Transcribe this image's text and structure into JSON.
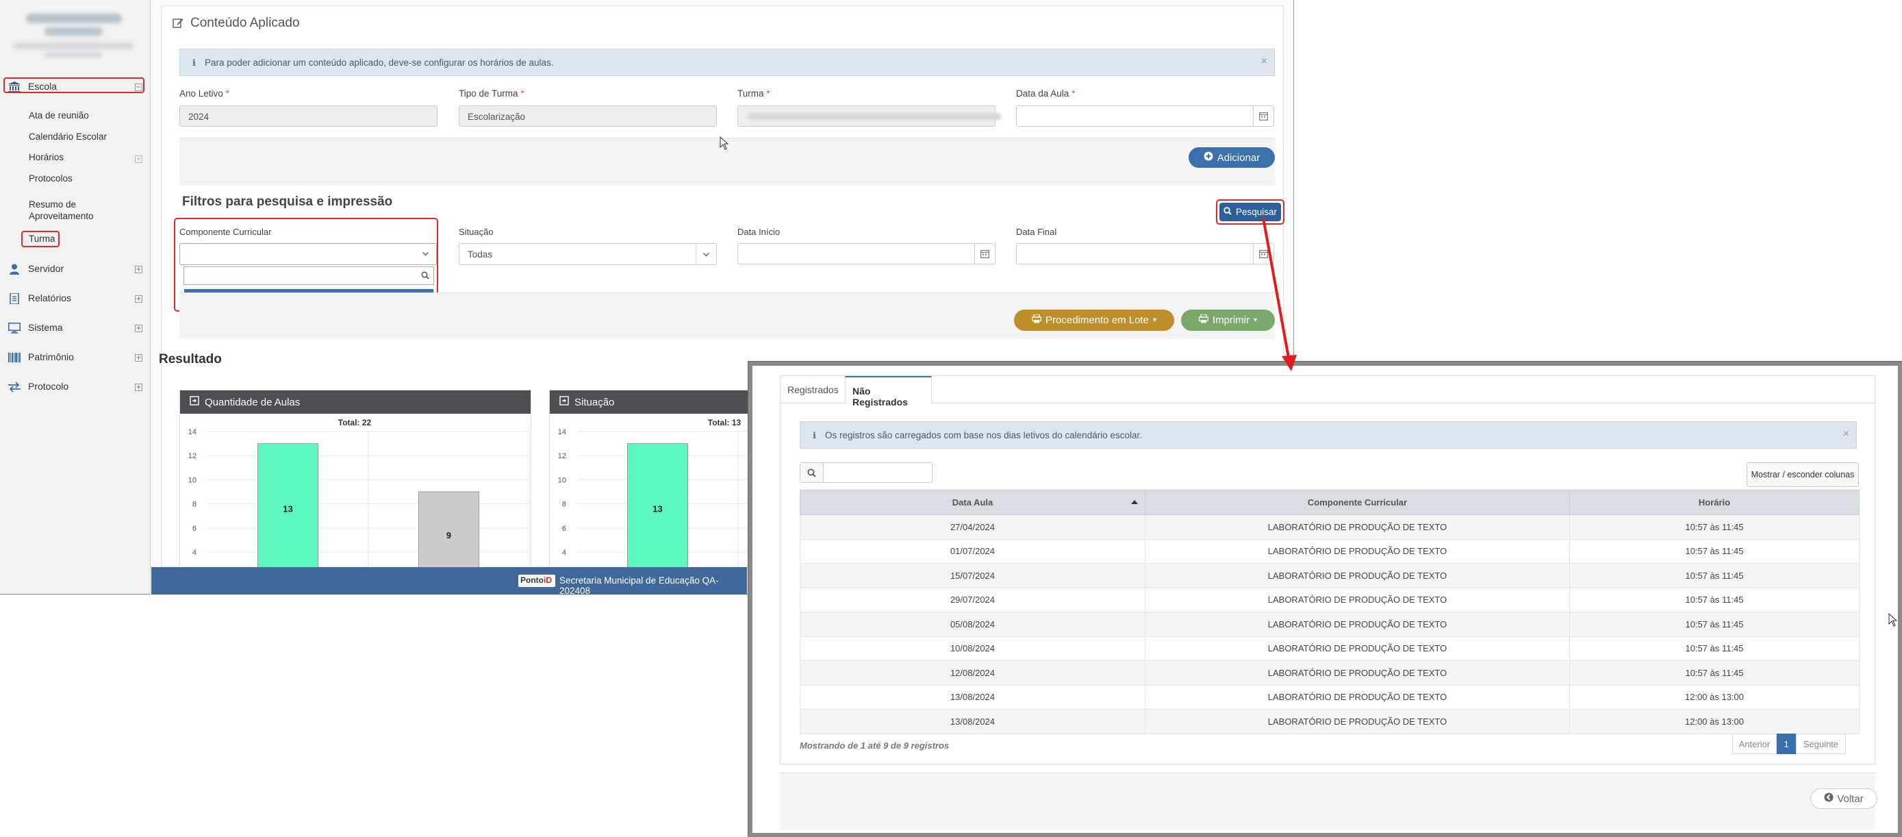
{
  "sidebar": {
    "menu": [
      {
        "label": "Escola",
        "icon": "bank-icon"
      },
      {
        "label": "Servidor",
        "icon": "user-icon"
      },
      {
        "label": "Relatórios",
        "icon": "report-icon"
      },
      {
        "label": "Sistema",
        "icon": "monitor-icon"
      },
      {
        "label": "Patrimônio",
        "icon": "barcode-icon"
      },
      {
        "label": "Protocolo",
        "icon": "exchange-icon"
      }
    ],
    "escola_sub": [
      "Ata de reunião",
      "Calendário Escolar",
      "Horários",
      "Protocolos",
      "Resumo de Aproveitamento",
      "Turma"
    ]
  },
  "page": {
    "title": "Conteúdo Aplicado",
    "alert": "Para poder adicionar um conteúdo aplicado, deve-se configurar os horários de aulas.",
    "fields": {
      "ano_letivo": {
        "label": "Ano Letivo",
        "value": "2024"
      },
      "tipo_turma": {
        "label": "Tipo de Turma",
        "value": "Escolarização"
      },
      "turma": {
        "label": "Turma",
        "value": ""
      },
      "data_aula": {
        "label": "Data da Aula",
        "value": ""
      }
    },
    "adicionar": "Adicionar"
  },
  "filters": {
    "title": "Filtros para pesquisa e impressão",
    "pesquisar": "Pesquisar",
    "componente_label": "Componente Curricular",
    "componente_option": "LABORATÓRIO DE PRODUÇÃO DE TEXTO",
    "situacao_label": "Situação",
    "situacao_value": "Todas",
    "data_inicio_label": "Data Início",
    "data_final_label": "Data Final",
    "procedimento": "Procedimento em Lote",
    "imprimir": "Imprimir"
  },
  "resultado": {
    "title": "Resultado",
    "charts": [
      "Quantidade de Aulas",
      "Situação"
    ]
  },
  "chart_data": [
    {
      "type": "bar",
      "title": "Quantidade de Aulas",
      "subtitle": "Total: 22",
      "values": [
        13,
        9
      ],
      "colors": [
        "#5cf8bf",
        "#cccccc"
      ],
      "yticks": [
        4,
        6,
        8,
        10,
        12,
        14
      ]
    },
    {
      "type": "bar",
      "title": "Situação",
      "subtitle": "Total: 13",
      "values": [
        13
      ],
      "colors": [
        "#5cf8bf"
      ],
      "yticks": [
        4,
        6,
        8,
        10,
        12,
        14
      ]
    }
  ],
  "footer": {
    "brand_a": "Ponto",
    "brand_b": "iD",
    "text": "Secretaria Municipal de Educação QA-202408"
  },
  "overlay": {
    "tabs": [
      "Registrados",
      "Não Registrados"
    ],
    "alert": "Os registros são carregados com base nos dias letivos do calendário escolar.",
    "cols_button": "Mostrar / esconder colunas",
    "columns": [
      "Data Aula",
      "Componente Curricular",
      "Horário"
    ],
    "rows": [
      [
        "27/04/2024",
        "LABORATÓRIO DE PRODUÇÃO DE TEXTO",
        "10:57 às 11:45"
      ],
      [
        "01/07/2024",
        "LABORATÓRIO DE PRODUÇÃO DE TEXTO",
        "10:57 às 11:45"
      ],
      [
        "15/07/2024",
        "LABORATÓRIO DE PRODUÇÃO DE TEXTO",
        "10:57 às 11:45"
      ],
      [
        "29/07/2024",
        "LABORATÓRIO DE PRODUÇÃO DE TEXTO",
        "10:57 às 11:45"
      ],
      [
        "05/08/2024",
        "LABORATÓRIO DE PRODUÇÃO DE TEXTO",
        "10:57 às 11:45"
      ],
      [
        "10/08/2024",
        "LABORATÓRIO DE PRODUÇÃO DE TEXTO",
        "10:57 às 11:45"
      ],
      [
        "12/08/2024",
        "LABORATÓRIO DE PRODUÇÃO DE TEXTO",
        "10:57 às 11:45"
      ],
      [
        "13/08/2024",
        "LABORATÓRIO DE PRODUÇÃO DE TEXTO",
        "12:00 às 13:00"
      ],
      [
        "13/08/2024",
        "LABORATÓRIO DE PRODUÇÃO DE TEXTO",
        "12:00 às 13:00"
      ]
    ],
    "info": "Mostrando de 1 até 9 de 9 registros",
    "pager": {
      "prev": "Anterior",
      "page": "1",
      "next": "Seguinte"
    },
    "voltar": "Voltar"
  },
  "colors": {
    "primary": "#3b6fae",
    "highlight": "#e02a2a",
    "warning_btn": "#bf8f2a",
    "success_btn": "#7aa86a",
    "chart_green": "#5cf8bf",
    "chart_gray": "#cccccc"
  }
}
